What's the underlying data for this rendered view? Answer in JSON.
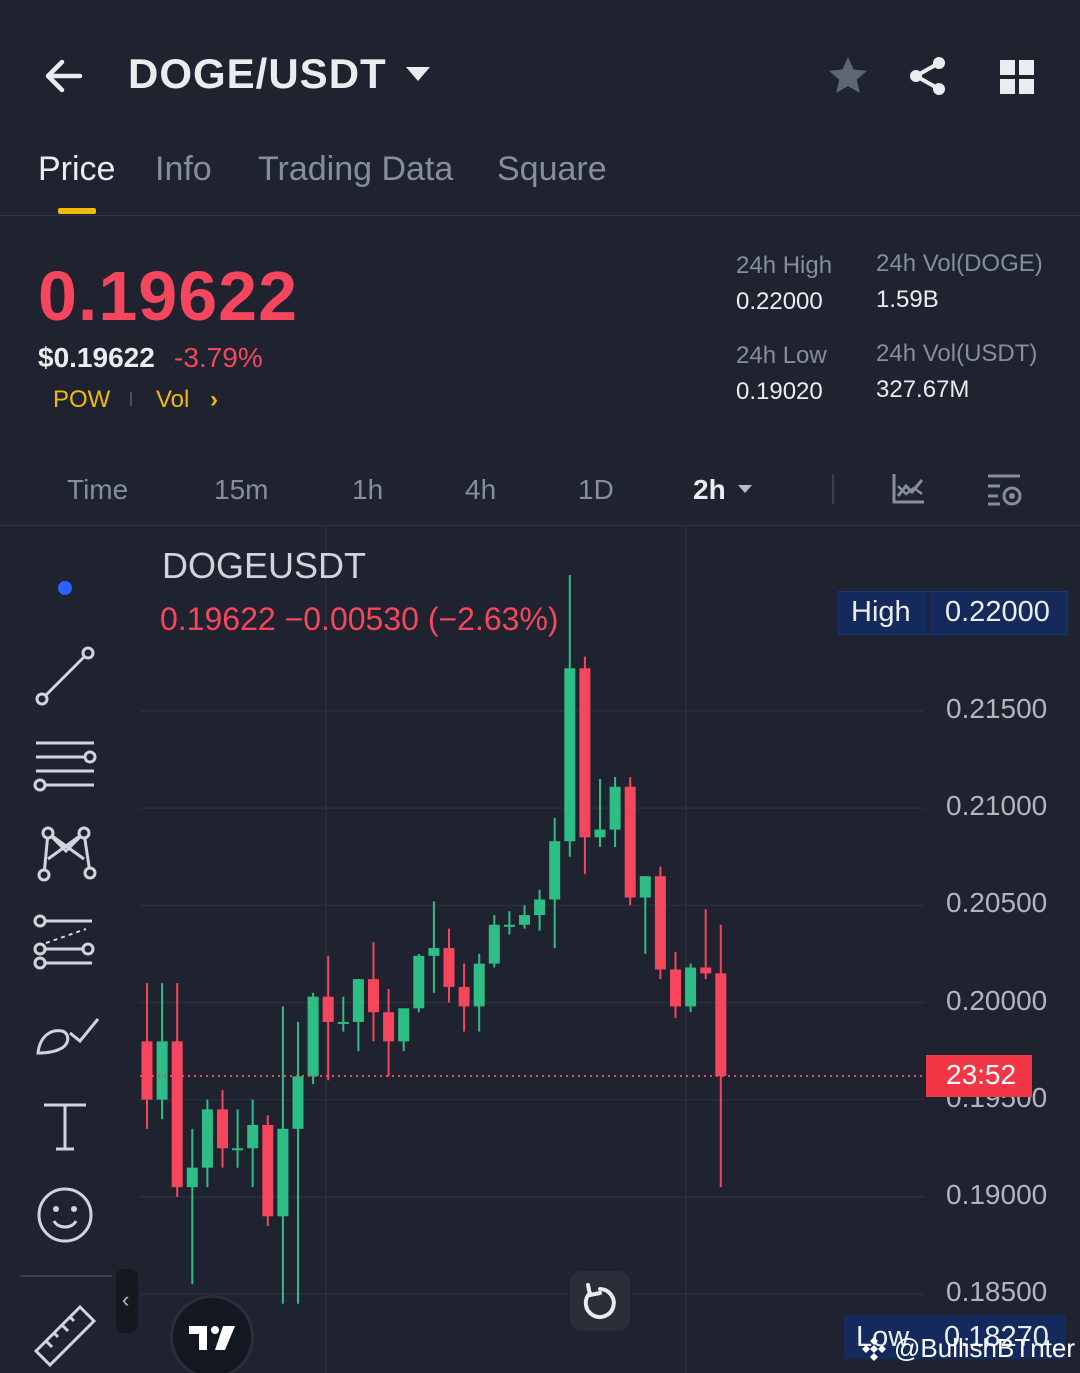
{
  "header": {
    "pair": "DOGE/USDT"
  },
  "tabs": [
    {
      "label": "Price"
    },
    {
      "label": "Info"
    },
    {
      "label": "Trading Data"
    },
    {
      "label": "Square"
    }
  ],
  "ticker": {
    "price": "0.19622",
    "usd_price": "$0.19622",
    "change_pct": "-3.79%",
    "tag_pow": "POW",
    "tag_vol": "Vol",
    "tag_vol_arrow": "›",
    "high_label": "24h High",
    "high_value": "0.22000",
    "low_label": "24h Low",
    "low_value": "0.19020",
    "vol_doge_label": "24h Vol(DOGE)",
    "vol_doge_value": "1.59B",
    "vol_usdt_label": "24h Vol(USDT)",
    "vol_usdt_value": "327.67M"
  },
  "intervals": [
    {
      "label": "Time"
    },
    {
      "label": "15m"
    },
    {
      "label": "1h"
    },
    {
      "label": "4h"
    },
    {
      "label": "1D"
    },
    {
      "label": "2h",
      "active": true
    }
  ],
  "chart": {
    "symbol": "DOGEUSDT",
    "legend": "0.19622  −0.00530 (−2.63%)",
    "high_label": "High",
    "high_value": "0.22000",
    "low_label": "Low",
    "low_value": "0.18270",
    "countdown": "23:52",
    "watermark": "@BullishBTnter",
    "colors": {
      "up": "#2ebd85",
      "down": "#f6465d",
      "accent": "#f0b90b"
    }
  },
  "chart_data": {
    "type": "candlestick",
    "yticks": [
      "0.21500",
      "0.21000",
      "0.20500",
      "0.20000",
      "0.19500",
      "0.19000",
      "0.18500"
    ],
    "ylim": [
      0.183,
      0.2225
    ],
    "last_price": 0.19622,
    "candles": [
      {
        "o": 0.198,
        "h": 0.201,
        "l": 0.1935,
        "c": 0.195
      },
      {
        "o": 0.195,
        "h": 0.201,
        "l": 0.194,
        "c": 0.198
      },
      {
        "o": 0.198,
        "h": 0.201,
        "l": 0.19,
        "c": 0.1905
      },
      {
        "o": 0.1905,
        "h": 0.1935,
        "l": 0.1855,
        "c": 0.1915
      },
      {
        "o": 0.1915,
        "h": 0.195,
        "l": 0.1905,
        "c": 0.1945
      },
      {
        "o": 0.1945,
        "h": 0.1955,
        "l": 0.1915,
        "c": 0.1925
      },
      {
        "o": 0.1925,
        "h": 0.1945,
        "l": 0.1915,
        "c": 0.1925
      },
      {
        "o": 0.1925,
        "h": 0.195,
        "l": 0.1905,
        "c": 0.1937
      },
      {
        "o": 0.1937,
        "h": 0.1942,
        "l": 0.1885,
        "c": 0.189
      },
      {
        "o": 0.189,
        "h": 0.1998,
        "l": 0.1845,
        "c": 0.1935
      },
      {
        "o": 0.1935,
        "h": 0.199,
        "l": 0.1845,
        "c": 0.1962
      },
      {
        "o": 0.1962,
        "h": 0.2005,
        "l": 0.1958,
        "c": 0.2003
      },
      {
        "o": 0.2003,
        "h": 0.2024,
        "l": 0.196,
        "c": 0.199
      },
      {
        "o": 0.199,
        "h": 0.2003,
        "l": 0.1985,
        "c": 0.199
      },
      {
        "o": 0.199,
        "h": 0.2012,
        "l": 0.1975,
        "c": 0.2012
      },
      {
        "o": 0.2012,
        "h": 0.2031,
        "l": 0.198,
        "c": 0.1995
      },
      {
        "o": 0.1995,
        "h": 0.2007,
        "l": 0.1962,
        "c": 0.198
      },
      {
        "o": 0.198,
        "h": 0.1997,
        "l": 0.1975,
        "c": 0.1997
      },
      {
        "o": 0.1997,
        "h": 0.2025,
        "l": 0.1995,
        "c": 0.2024
      },
      {
        "o": 0.2024,
        "h": 0.2052,
        "l": 0.2005,
        "c": 0.2028
      },
      {
        "o": 0.2028,
        "h": 0.2038,
        "l": 0.2,
        "c": 0.2008
      },
      {
        "o": 0.2008,
        "h": 0.202,
        "l": 0.1985,
        "c": 0.1998
      },
      {
        "o": 0.1998,
        "h": 0.2025,
        "l": 0.1985,
        "c": 0.202
      },
      {
        "o": 0.202,
        "h": 0.2045,
        "l": 0.2018,
        "c": 0.204
      },
      {
        "o": 0.204,
        "h": 0.2047,
        "l": 0.2035,
        "c": 0.204
      },
      {
        "o": 0.204,
        "h": 0.205,
        "l": 0.2038,
        "c": 0.2045
      },
      {
        "o": 0.2045,
        "h": 0.2058,
        "l": 0.2037,
        "c": 0.2053
      },
      {
        "o": 0.2053,
        "h": 0.2095,
        "l": 0.2028,
        "c": 0.2083
      },
      {
        "o": 0.2083,
        "h": 0.222,
        "l": 0.2075,
        "c": 0.2172
      },
      {
        "o": 0.2172,
        "h": 0.2178,
        "l": 0.2066,
        "c": 0.2085
      },
      {
        "o": 0.2085,
        "h": 0.2115,
        "l": 0.208,
        "c": 0.2089
      },
      {
        "o": 0.2089,
        "h": 0.2116,
        "l": 0.208,
        "c": 0.2111
      },
      {
        "o": 0.2111,
        "h": 0.2116,
        "l": 0.205,
        "c": 0.2054
      },
      {
        "o": 0.2054,
        "h": 0.2065,
        "l": 0.2025,
        "c": 0.2065
      },
      {
        "o": 0.2065,
        "h": 0.207,
        "l": 0.2012,
        "c": 0.2017
      },
      {
        "o": 0.2017,
        "h": 0.2026,
        "l": 0.1992,
        "c": 0.1998
      },
      {
        "o": 0.1998,
        "h": 0.202,
        "l": 0.1995,
        "c": 0.2018
      },
      {
        "o": 0.2018,
        "h": 0.2048,
        "l": 0.2012,
        "c": 0.2015
      },
      {
        "o": 0.2015,
        "h": 0.204,
        "l": 0.1905,
        "c": 0.19622
      }
    ]
  }
}
